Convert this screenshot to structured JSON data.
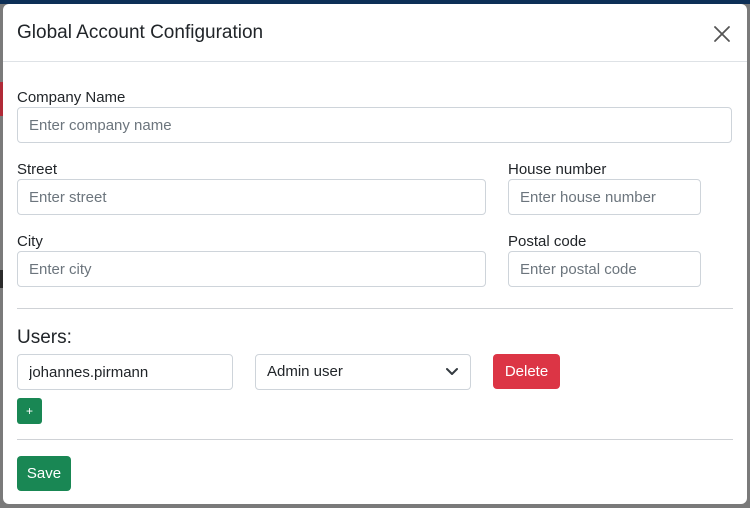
{
  "colors": {
    "primary_dark": "#0d2f57",
    "danger": "#dc3545",
    "success": "#198754",
    "border": "#ced4da",
    "placeholder": "#6c757d"
  },
  "modal": {
    "title": "Global Account Configuration",
    "close_icon": "close-icon"
  },
  "form": {
    "company_name": {
      "label": "Company Name",
      "placeholder": "Enter company name",
      "value": ""
    },
    "street": {
      "label": "Street",
      "placeholder": "Enter street",
      "value": ""
    },
    "house_number": {
      "label": "House number",
      "placeholder": "Enter house number",
      "value": ""
    },
    "city": {
      "label": "City",
      "placeholder": "Enter city",
      "value": ""
    },
    "postal_code": {
      "label": "Postal code",
      "placeholder": "Enter postal code",
      "value": ""
    }
  },
  "users": {
    "heading": "Users:",
    "rows": [
      {
        "username": "johannes.pirmann",
        "role": "Admin user",
        "delete_label": "Delete"
      }
    ],
    "add_label": "+"
  },
  "footer": {
    "save_label": "Save"
  }
}
